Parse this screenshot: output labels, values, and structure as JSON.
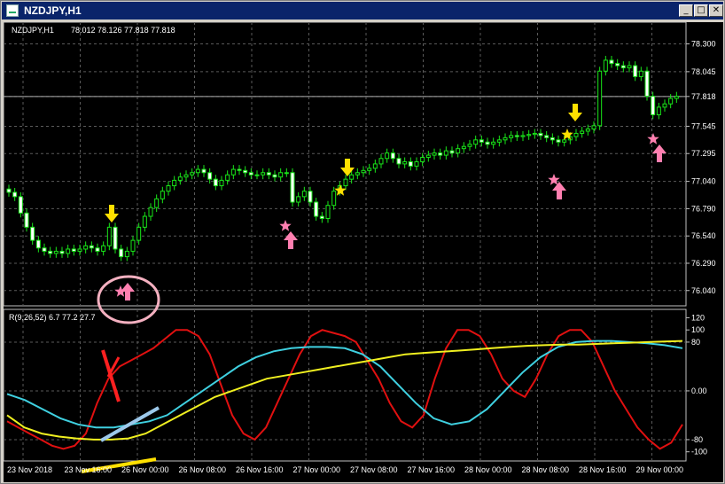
{
  "window": {
    "title": "NZDJPY,H1",
    "min_glyph": "_",
    "max_glyph": "□",
    "close_glyph": "✕"
  },
  "main_pane": {
    "symbol_label": "NZDJPY,H1",
    "ohlc_label": "78.012 78.126 77.818 77.818",
    "current_price_label": "77.818"
  },
  "indicator_pane": {
    "label": "R(9,26,52) 6.7 77.2 27.7"
  },
  "colors": {
    "background": "#000000",
    "grid": "#5a5a5a",
    "candle": "#19e619",
    "text": "#ffffff",
    "red_line": "#e01010",
    "cyan_line": "#3fd0e0",
    "yellow_line": "#f0f020",
    "annotation_yellow": "#ffe000",
    "annotation_pink": "#ff7fb0",
    "annotation_red": "#ff2020",
    "annotation_lightblue": "#9cc8ea",
    "circle_pink": "#f4b0c0"
  },
  "chart_data": [
    {
      "type": "candlestick",
      "title": "NZDJPY,H1",
      "ylim": [
        75.9,
        78.45
      ],
      "y_ticks": [
        "78.300",
        "78.045",
        "77.818",
        "77.545",
        "77.295",
        "77.040",
        "76.790",
        "76.540",
        "76.290",
        "76.040"
      ],
      "x_ticks": [
        "23 Nov 2018",
        "23 Nov 16:00",
        "26 Nov 00:00",
        "26 Nov 08:00",
        "26 Nov 16:00",
        "27 Nov 00:00",
        "27 Nov 08:00",
        "27 Nov 16:00",
        "28 Nov 00:00",
        "28 Nov 08:00",
        "28 Nov 16:00",
        "29 Nov 00:00"
      ],
      "closes": [
        76.94,
        76.9,
        76.75,
        76.62,
        76.5,
        76.43,
        76.4,
        76.38,
        76.4,
        76.38,
        76.42,
        76.4,
        76.42,
        76.45,
        76.43,
        76.4,
        76.45,
        76.62,
        76.42,
        76.35,
        76.4,
        76.5,
        76.62,
        76.72,
        76.8,
        76.88,
        76.95,
        77.0,
        77.05,
        77.08,
        77.1,
        77.12,
        77.15,
        77.12,
        77.06,
        77.0,
        77.05,
        77.1,
        77.15,
        77.14,
        77.12,
        77.1,
        77.1,
        77.12,
        77.1,
        77.08,
        77.12,
        77.12,
        76.85,
        76.9,
        76.95,
        76.85,
        76.72,
        76.7,
        76.82,
        76.95,
        77.0,
        77.06,
        77.1,
        77.12,
        77.14,
        77.16,
        77.2,
        77.25,
        77.3,
        77.25,
        77.2,
        77.22,
        77.18,
        77.22,
        77.26,
        77.28,
        77.3,
        77.28,
        77.32,
        77.3,
        77.34,
        77.36,
        77.38,
        77.42,
        77.4,
        77.38,
        77.4,
        77.42,
        77.44,
        77.46,
        77.45,
        77.46,
        77.47,
        77.48,
        77.46,
        77.44,
        77.42,
        77.4,
        77.42,
        77.45,
        77.48,
        77.5,
        77.52,
        77.55,
        78.05,
        78.15,
        78.12,
        78.1,
        78.08,
        78.1,
        78.0,
        78.05,
        77.82,
        77.65,
        77.72,
        77.75,
        77.8,
        77.82
      ],
      "annotations": [
        "down-arrow",
        "down-arrow",
        "down-arrow",
        "star",
        "star",
        "up-arrow",
        "up-arrow",
        "up-arrow",
        "up-arrow"
      ]
    },
    {
      "type": "line",
      "title": "R(9,26,52) 6.7 77.2 27.7",
      "ylim": [
        -115,
        125
      ],
      "y_ticks": [
        "120",
        "100",
        "80",
        "0.00",
        "-80",
        "-100"
      ],
      "series": [
        {
          "color": "#e01010",
          "values": [
            -50,
            -60,
            -70,
            -80,
            -90,
            -95,
            -90,
            -70,
            -20,
            20,
            40,
            50,
            60,
            70,
            85,
            100,
            100,
            90,
            60,
            10,
            -40,
            -70,
            -80,
            -60,
            -20,
            20,
            60,
            90,
            100,
            95,
            90,
            80,
            50,
            20,
            -20,
            -50,
            -60,
            -40,
            20,
            70,
            100,
            100,
            90,
            60,
            20,
            0,
            -10,
            20,
            60,
            90,
            100,
            100,
            80,
            40,
            0,
            -30,
            -60,
            -80,
            -95,
            -85,
            -55
          ]
        },
        {
          "color": "#3fd0e0",
          "values": [
            -5,
            -15,
            -30,
            -45,
            -55,
            -60,
            -60,
            -55,
            -50,
            -40,
            -20,
            0,
            20,
            40,
            55,
            65,
            70,
            72,
            72,
            70,
            60,
            40,
            10,
            -20,
            -45,
            -55,
            -50,
            -30,
            0,
            30,
            55,
            72,
            80,
            82,
            82,
            80,
            78,
            75,
            70
          ]
        },
        {
          "color": "#f0f020",
          "values": [
            -40,
            -60,
            -70,
            -75,
            -78,
            -80,
            -80,
            -78,
            -70,
            -55,
            -40,
            -25,
            -10,
            0,
            10,
            20,
            25,
            30,
            35,
            40,
            45,
            50,
            55,
            60,
            62,
            64,
            66,
            68,
            70,
            72,
            74,
            75,
            76,
            76,
            77,
            78,
            79,
            80,
            81,
            82
          ]
        }
      ]
    }
  ]
}
